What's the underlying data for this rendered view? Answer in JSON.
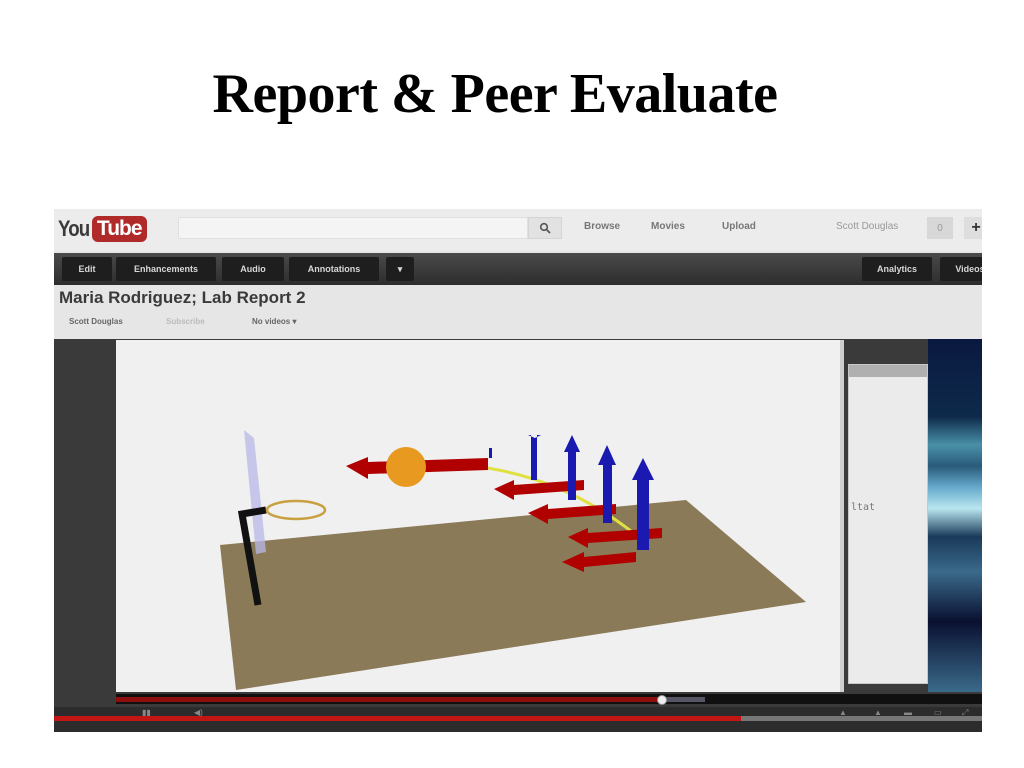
{
  "slide": {
    "title": "Report & Peer Evaluate"
  },
  "youtube": {
    "logo": {
      "you": "You",
      "tube": "Tube"
    },
    "search": {
      "placeholder": "",
      "button_icon": "search-icon"
    },
    "nav": [
      "Browse",
      "Movies",
      "Upload"
    ],
    "user": {
      "name": "Scott Douglas",
      "notifications": "0",
      "plus_icon": "+"
    },
    "toolbar": {
      "left": [
        "Edit",
        "Enhancements",
        "Audio",
        "Annotations",
        "▾"
      ],
      "right": [
        "Analytics",
        "Videos"
      ]
    },
    "video_title": "Maria Rodriguez; Lab Report 2",
    "sub_row": {
      "owner": "Scott Douglas",
      "subscribe": "Subscribe",
      "videos_select": "No videos ▾"
    },
    "side_panel_text": "ltat",
    "player": {
      "played_fraction": 0.63,
      "buffered_fraction": 0.68,
      "total_progress_fraction": 0.74
    }
  },
  "colors": {
    "youtube_red": "#b02a2a",
    "progress_red": "#c41515",
    "force_arrow_red": "#b00000",
    "velocity_arrow_blue": "#1a1ab0",
    "ball_orange": "#e89a20",
    "floor_tan": "#8b7a58"
  }
}
